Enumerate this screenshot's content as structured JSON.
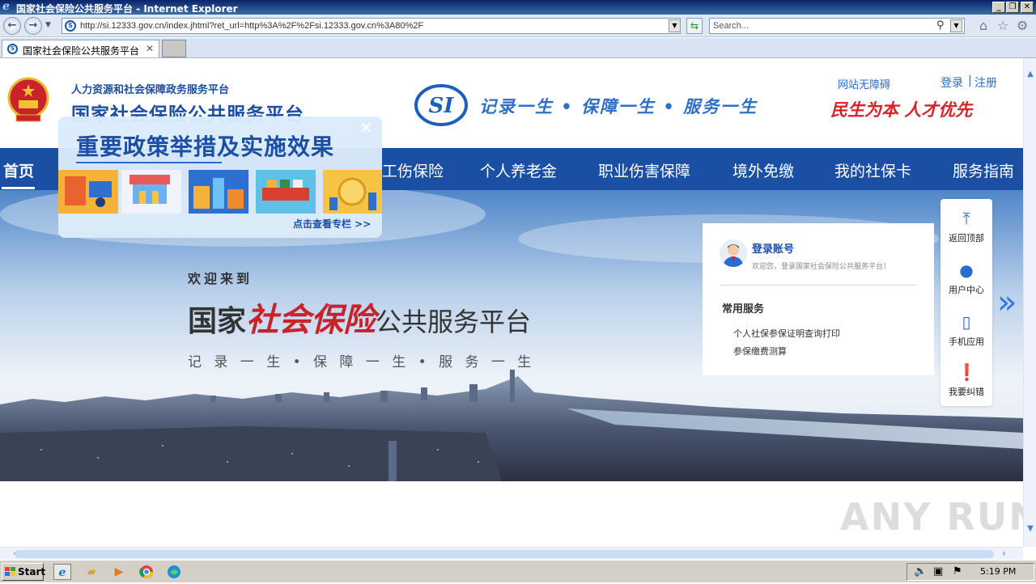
{
  "browser": {
    "window_title": "国家社会保险公共服务平台 - Internet Explorer",
    "url": "http://si.12333.gov.cn/index.jhtml?ret_url=http%3A%2F%2Fsi.12333.gov.cn%3A80%2F",
    "search_placeholder": "Search...",
    "tab_title": "国家社会保险公共服务平台"
  },
  "header": {
    "ministry": "人力资源和社会保障政务服务平台",
    "site_title": "国家社会保险公共服务平台",
    "slogan": "记录一生 • 保障一生 • 服务一生",
    "barrier_free": "网站无障碍",
    "login": "登录",
    "separator": "|",
    "register": "注册",
    "red_slogan": "民生为本 人才优先"
  },
  "nav": {
    "items": [
      "首页",
      "工伤保险",
      "个人养老金",
      "职业伤害保障",
      "境外免缴",
      "我的社保卡",
      "服务指南"
    ]
  },
  "hero": {
    "welcome": "欢迎来到",
    "title_a": "国家",
    "title_b": "社会保险",
    "title_c": "公共服务平台",
    "slogan": "记 录 一 生 • 保 障 一 生 • 服 务 一 生"
  },
  "login_panel": {
    "account_label": "登录账号",
    "welcome_sub": "欢迎您，登录国家社会保险公共服务平台！",
    "common_services": "常用服务",
    "services": [
      "个人社保参保证明查询打印",
      "参保缴费测算"
    ]
  },
  "float_bar": {
    "items": [
      {
        "label": "返回顶部",
        "icon": "arrow-up-icon"
      },
      {
        "label": "用户中心",
        "icon": "user-icon"
      },
      {
        "label": "手机应用",
        "icon": "phone-icon"
      },
      {
        "label": "我要纠错",
        "icon": "alert-icon"
      }
    ]
  },
  "popup": {
    "close": "✕",
    "title": "重要政策举措及实施效果",
    "link": "点击查看专栏 >>"
  },
  "watermark": "ANY RUN",
  "taskbar": {
    "start": "Start",
    "time": "5:19 PM"
  },
  "colors": {
    "brand_blue": "#1b4fa3",
    "accent_red": "#c8222a",
    "link_blue": "#2a6bc4"
  }
}
